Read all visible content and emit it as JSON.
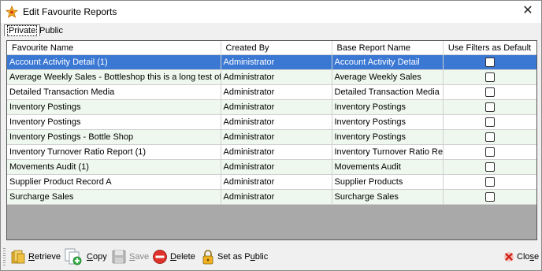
{
  "window": {
    "title": "Edit Favourite Reports",
    "close_glyph": "✕"
  },
  "tabs": [
    {
      "label": "Private",
      "active": true
    },
    {
      "label": "Public",
      "active": false
    }
  ],
  "grid": {
    "columns": [
      "Favourite Name",
      "Created By",
      "Base Report Name",
      "Use Filters as Default"
    ],
    "rows": [
      {
        "name": "Account Activity Detail (1)",
        "created_by": "Administrator",
        "base": "Account Activity Detail",
        "use_filters": false
      },
      {
        "name": "Average Weekly Sales - Bottleshop this is a long test of this field",
        "created_by": "Administrator",
        "base": "Average Weekly Sales",
        "use_filters": false
      },
      {
        "name": "Detailed Transaction Media",
        "created_by": "Administrator",
        "base": "Detailed Transaction Media",
        "use_filters": false
      },
      {
        "name": "Inventory Postings",
        "created_by": "Administrator",
        "base": "Inventory Postings",
        "use_filters": false
      },
      {
        "name": "Inventory Postings",
        "created_by": "Administrator",
        "base": "Inventory Postings",
        "use_filters": false
      },
      {
        "name": "Inventory Postings - Bottle Shop",
        "created_by": "Administrator",
        "base": "Inventory Postings",
        "use_filters": false
      },
      {
        "name": "Inventory Turnover Ratio Report (1)",
        "created_by": "Administrator",
        "base": "Inventory Turnover Ratio Report",
        "use_filters": false
      },
      {
        "name": "Movements Audit (1)",
        "created_by": "Administrator",
        "base": "Movements Audit",
        "use_filters": false
      },
      {
        "name": "Supplier Product Record A",
        "created_by": "Administrator",
        "base": "Supplier Products",
        "use_filters": false
      },
      {
        "name": "Surcharge Sales",
        "created_by": "Administrator",
        "base": "Surcharge Sales",
        "use_filters": false
      }
    ],
    "selected_row": 0
  },
  "toolbar": {
    "retrieve": {
      "pre": "",
      "key": "R",
      "post": "etrieve"
    },
    "copy": {
      "pre": "",
      "key": "C",
      "post": "opy"
    },
    "save": {
      "pre": "",
      "key": "S",
      "post": "ave"
    },
    "delete": {
      "pre": "",
      "key": "D",
      "post": "elete"
    },
    "public": {
      "pre": "Set as P",
      "key": "u",
      "post": "blic"
    },
    "close": {
      "pre": "Clo",
      "key": "s",
      "post": "e"
    }
  },
  "colors": {
    "selection": "#3a78d4",
    "alt_row": "#eef8ee",
    "grid_background": "#a9a9a9"
  }
}
